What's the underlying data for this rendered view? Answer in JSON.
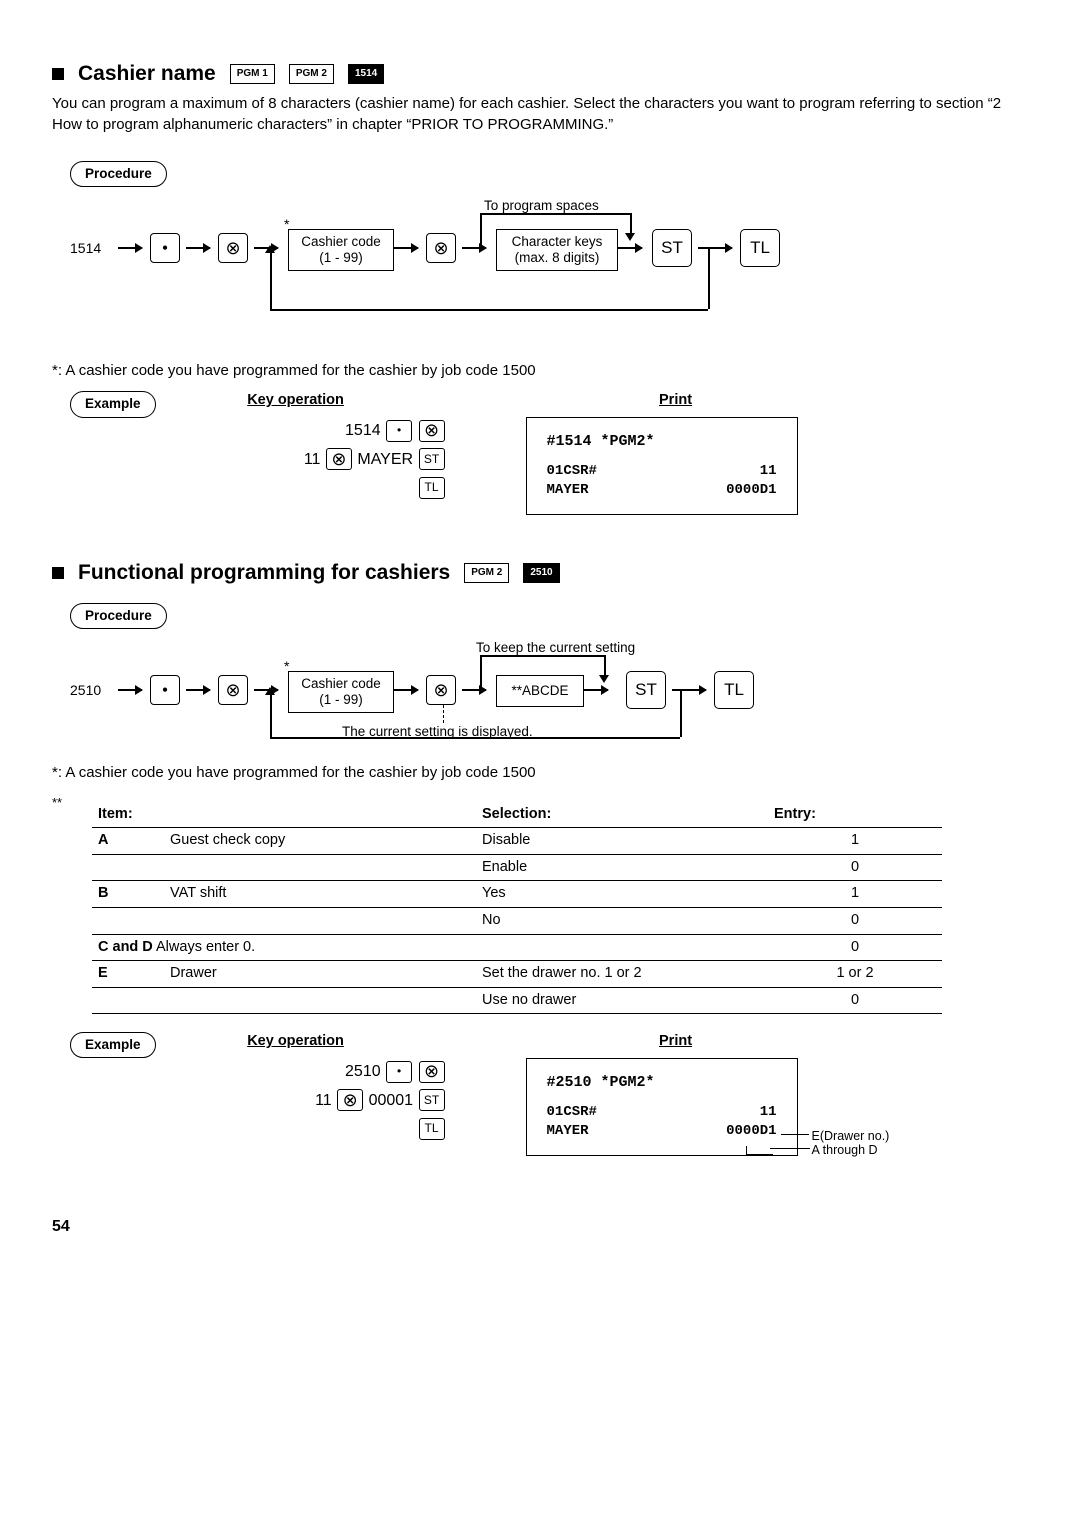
{
  "section1": {
    "title": "Cashier name",
    "tags": [
      "PGM 1",
      "PGM 2",
      "1514"
    ],
    "description": "You can program a maximum of 8 characters (cashier name) for each cashier. Select the characters you want to program referring to section “2 How to program alphanumeric characters” in chapter “PRIOR TO PROGRAMMING.”",
    "procedure_label": "Procedure",
    "diag": {
      "start": "1514",
      "spaces_label": "To program spaces",
      "cashier_box_l1": "Cashier code",
      "cashier_box_l2": "(1 - 99)",
      "char_box_l1": "Character keys",
      "char_box_l2": "(max. 8 digits)",
      "asterisk": "*",
      "st": "ST",
      "tl": "TL"
    },
    "note": "*: A cashier code you have programmed for the cashier by job code 1500",
    "example_label": "Example",
    "keyop_title": "Key operation",
    "print_title": "Print",
    "keyop": {
      "l1_a": "1514",
      "l2_a": "11",
      "l2_b": "MAYER"
    },
    "print": {
      "r1": "#1514 *PGM2*",
      "r2a": "01CSR#",
      "r2b": "11",
      "r3a": "MAYER",
      "r3b": "0000D1"
    }
  },
  "section2": {
    "title": "Functional programming for cashiers",
    "tags": [
      "PGM 2",
      "2510"
    ],
    "procedure_label": "Procedure",
    "diag": {
      "start": "2510",
      "keep_label": "To keep the current setting",
      "cashier_box_l1": "Cashier code",
      "cashier_box_l2": "(1 - 99)",
      "abcde": "**ABCDE",
      "current_label": "The current setting is displayed.",
      "asterisk": "*",
      "st": "ST",
      "tl": "TL"
    },
    "note": "*: A cashier code you have programmed for the cashier by job code 1500",
    "table_prefix": "**",
    "table_headers": [
      "Item:",
      "Selection:",
      "Entry:"
    ],
    "rows": [
      {
        "item": "A",
        "label": "Guest check copy",
        "sel": "Disable",
        "entry": "1"
      },
      {
        "item": "",
        "label": "",
        "sel": "Enable",
        "entry": "0"
      },
      {
        "item": "B",
        "label": "VAT shift",
        "sel": "Yes",
        "entry": "1"
      },
      {
        "item": "",
        "label": "",
        "sel": "No",
        "entry": "0"
      },
      {
        "item": "C and D",
        "label": "Always enter 0.",
        "sel": "",
        "entry": "0"
      },
      {
        "item": "E",
        "label": "Drawer",
        "sel": "Set the drawer no. 1 or 2",
        "entry": "1 or 2"
      },
      {
        "item": "",
        "label": "",
        "sel": "Use no drawer",
        "entry": "0"
      }
    ],
    "example_label": "Example",
    "keyop_title": "Key operation",
    "print_title": "Print",
    "keyop": {
      "l1_a": "2510",
      "l2_a": "11",
      "l2_b": "00001"
    },
    "print": {
      "r1": "#2510 *PGM2*",
      "r2a": "01CSR#",
      "r2b": "11",
      "r3a": "MAYER",
      "r3b": "0000D1"
    },
    "callouts": {
      "c1": "E(Drawer no.)",
      "c2": "A through D"
    }
  },
  "page_number": "54",
  "icons": {
    "dot": "•",
    "otimes": "⊗",
    "st": "ST",
    "tl": "TL"
  }
}
